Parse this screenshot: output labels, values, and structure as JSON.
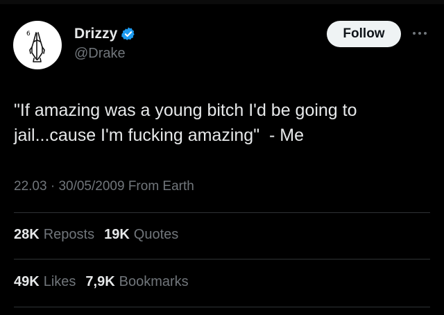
{
  "colors": {
    "background": "#000000",
    "text_primary": "#e7e9ea",
    "text_secondary": "#71767b",
    "verified_blue": "#1d9bf0",
    "follow_bg": "#eff3f4",
    "divider": "#2f3336"
  },
  "author": {
    "display_name": "Drizzy",
    "handle": "@Drake",
    "verified_icon": "verified-badge-icon",
    "avatar_icon": "praying-hands-icon",
    "avatar_number": "6"
  },
  "actions": {
    "follow_label": "Follow",
    "more_icon": "more-horizontal-icon"
  },
  "tweet": {
    "text": "\"If amazing was a young bitch I'd be going to\njail...cause I'm fucking amazing\"  - Me",
    "time": "22.03",
    "separator": "·",
    "date": "30/05/2009",
    "source": "From Earth"
  },
  "stats": {
    "reposts_count": "28K",
    "reposts_label": "Reposts",
    "quotes_count": "19K",
    "quotes_label": "Quotes",
    "likes_count": "49K",
    "likes_label": "Likes",
    "bookmarks_count": "7,9K",
    "bookmarks_label": "Bookmarks"
  }
}
